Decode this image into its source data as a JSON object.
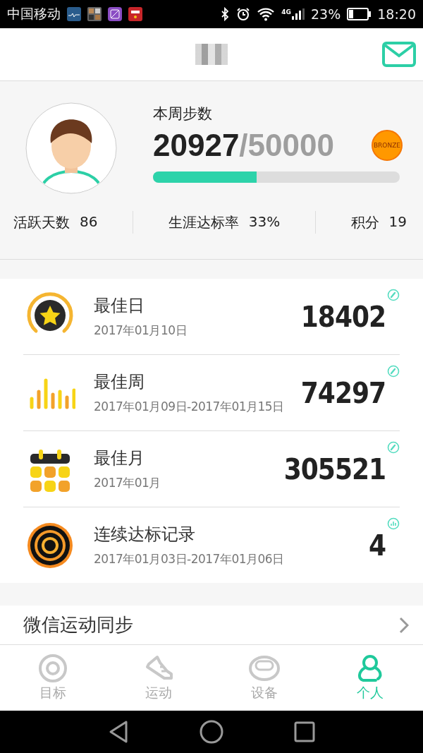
{
  "status_bar": {
    "carrier": "中国移动",
    "network": "4G",
    "battery": "23%",
    "time": "18:20"
  },
  "header": {
    "kind": "blurred-title"
  },
  "weekly": {
    "label": "本周步数",
    "steps": "20927",
    "goal": "/50000",
    "level": 0.42,
    "badge": "BRONZE"
  },
  "stats": [
    {
      "label": "活跃天数",
      "value": "86"
    },
    {
      "label": "生涯达标率",
      "value": "33%"
    },
    {
      "label": "积分",
      "value": "19"
    }
  ],
  "records": [
    {
      "kind": "star",
      "title": "最佳日",
      "date": "2017年01月10日",
      "value": "18402",
      "action": {
        "kind": "edit"
      }
    },
    {
      "kind": "bars",
      "title": "最佳周",
      "date": "2017年01月09日-2017年01月15日",
      "value": "74297",
      "action": {
        "kind": "edit"
      }
    },
    {
      "kind": "calendar",
      "title": "最佳月",
      "date": "2017年01月",
      "value": "305521",
      "action": {
        "kind": "edit"
      }
    },
    {
      "kind": "target",
      "title": "连续达标记录",
      "date": "2017年01月03日-2017年01月06日",
      "value": "4",
      "action": {
        "kind": "chart"
      }
    }
  ],
  "settings": [
    {
      "label": "微信运动同步"
    }
  ],
  "tabs": [
    {
      "kind": "target",
      "label": "目标",
      "selected": false
    },
    {
      "kind": "shoe",
      "label": "运动",
      "selected": false
    },
    {
      "kind": "band",
      "label": "设备",
      "selected": false
    },
    {
      "kind": "person",
      "label": "个人",
      "selected": true
    }
  ]
}
